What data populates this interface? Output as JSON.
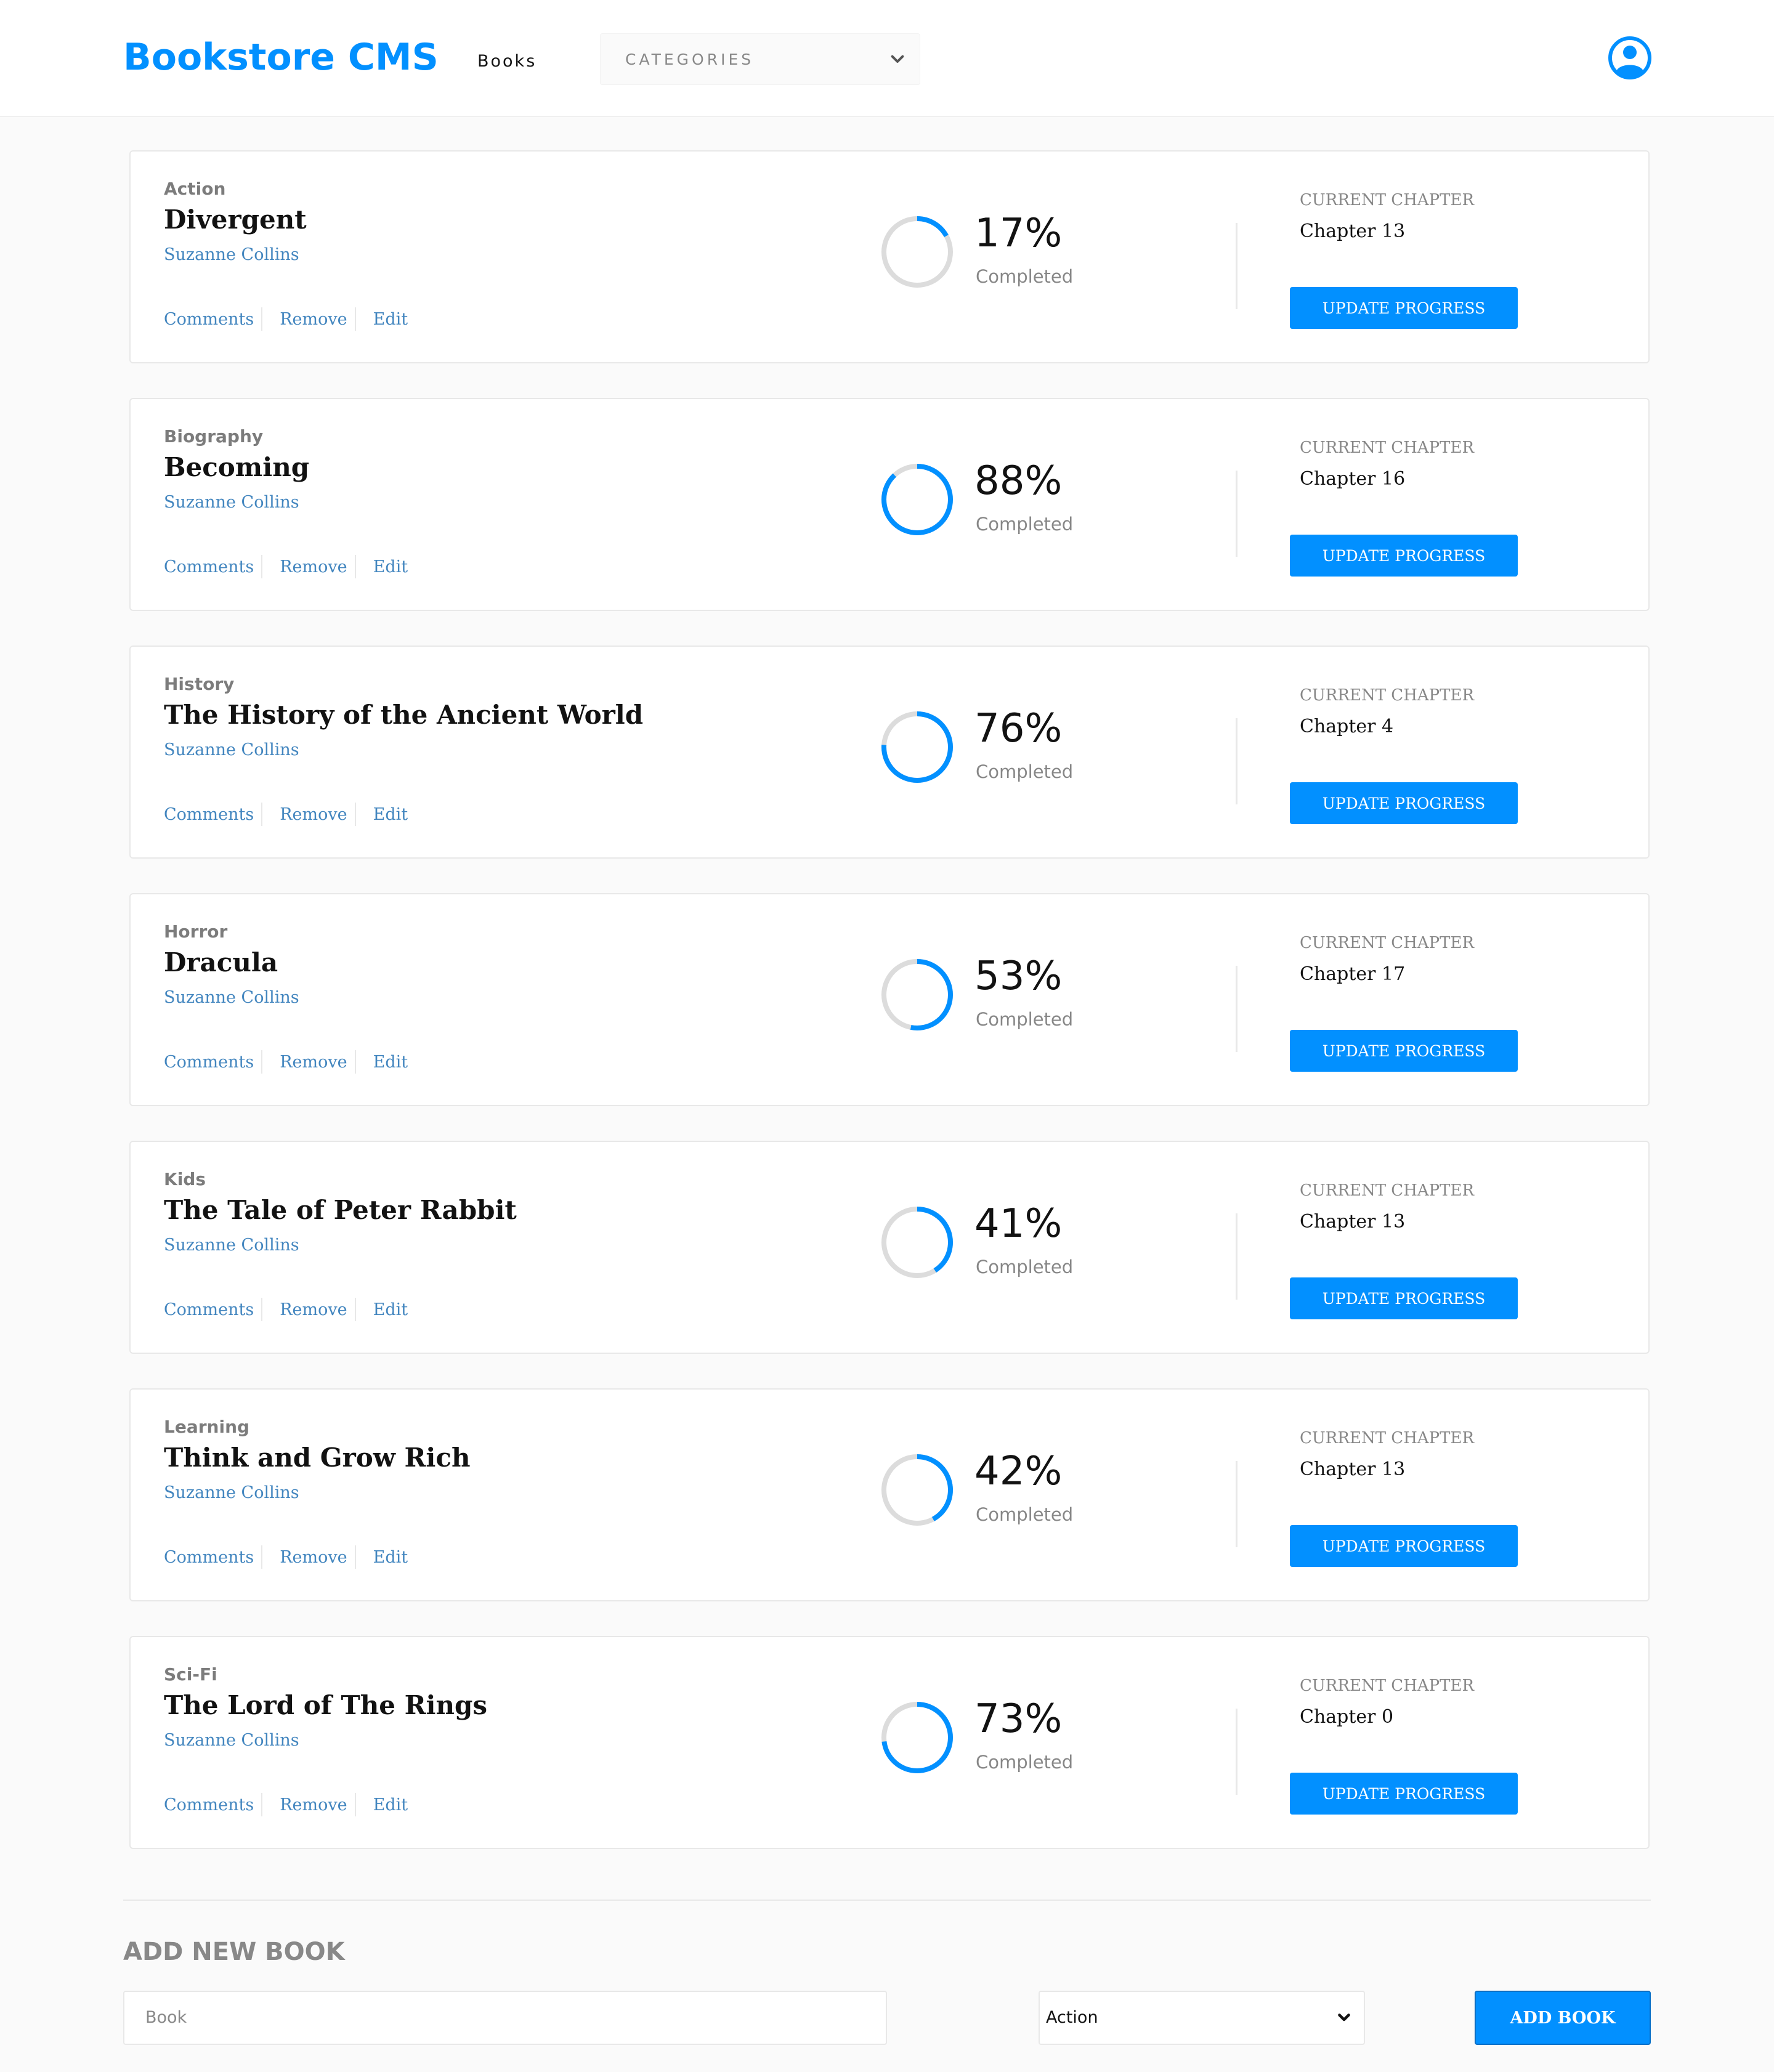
{
  "header": {
    "logo": "Bookstore CMS",
    "nav_books": "Books",
    "categories_placeholder": "CATEGORIES"
  },
  "colors": {
    "accent": "#0290ff",
    "link": "#4386bf",
    "ring_track": "#e8e8e8"
  },
  "icons": [
    "user-avatar-icon",
    "chevron-down-icon"
  ],
  "books": [
    {
      "genre": "Action",
      "title": "Divergent",
      "author": "Suzanne Collins",
      "percent": 17,
      "percent_label": "17%",
      "chapter": "Chapter 13"
    },
    {
      "genre": "Biography",
      "title": "Becoming",
      "author": "Suzanne Collins",
      "percent": 88,
      "percent_label": "88%",
      "chapter": "Chapter 16"
    },
    {
      "genre": "History",
      "title": "The History of the Ancient World",
      "author": "Suzanne Collins",
      "percent": 76,
      "percent_label": "76%",
      "chapter": "Chapter 4"
    },
    {
      "genre": "Horror",
      "title": "Dracula",
      "author": "Suzanne Collins",
      "percent": 53,
      "percent_label": "53%",
      "chapter": "Chapter 17"
    },
    {
      "genre": "Kids",
      "title": "The Tale of Peter Rabbit",
      "author": "Suzanne Collins",
      "percent": 41,
      "percent_label": "41%",
      "chapter": "Chapter 13"
    },
    {
      "genre": "Learning",
      "title": "Think and Grow Rich",
      "author": "Suzanne Collins",
      "percent": 42,
      "percent_label": "42%",
      "chapter": "Chapter 13"
    },
    {
      "genre": "Sci-Fi",
      "title": "The Lord of The Rings",
      "author": "Suzanne Collins",
      "percent": 73,
      "percent_label": "73%",
      "chapter": "Chapter 0"
    }
  ],
  "card_labels": {
    "comments": "Comments",
    "remove": "Remove",
    "edit": "Edit",
    "completed": "Completed",
    "current_chapter": "CURRENT CHAPTER",
    "update_progress": "UPDATE PROGRESS"
  },
  "form": {
    "title": "ADD NEW BOOK",
    "book_placeholder": "Book",
    "category_selected": "Action",
    "submit": "ADD BOOK"
  }
}
